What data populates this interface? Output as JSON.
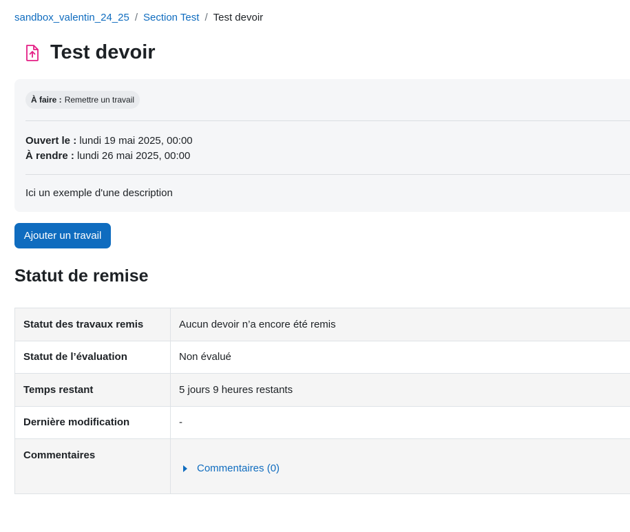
{
  "breadcrumb": {
    "items": [
      {
        "label": "sandbox_valentin_24_25"
      },
      {
        "label": "Section Test"
      }
    ],
    "current": "Test devoir",
    "separator": "/"
  },
  "page": {
    "title": "Test devoir",
    "icon": "assignment-upload-icon",
    "icon_color": "#e41e85"
  },
  "activity": {
    "todo_label": "À faire :",
    "todo_value": "Remettre un travail",
    "opened_label": "Ouvert le :",
    "opened_value": "lundi 19 mai 2025, 00:00",
    "due_label": "À rendre :",
    "due_value": "lundi 26 mai 2025, 00:00",
    "description": "Ici un exemple d'une description"
  },
  "actions": {
    "add_submission": "Ajouter un travail"
  },
  "submission_status": {
    "heading": "Statut de remise",
    "rows": [
      {
        "label": "Statut des travaux remis",
        "value": "Aucun devoir n’a encore été remis"
      },
      {
        "label": "Statut de l’évaluation",
        "value": "Non évalué"
      },
      {
        "label": "Temps restant",
        "value": "5 jours 9 heures restants"
      },
      {
        "label": "Dernière modification",
        "value": "-"
      },
      {
        "label": "Commentaires",
        "value": "Commentaires (0)"
      }
    ]
  },
  "colors": {
    "link": "#0f6cbf",
    "primary_button": "#0f6cbf",
    "activity_icon": "#e41e85"
  }
}
